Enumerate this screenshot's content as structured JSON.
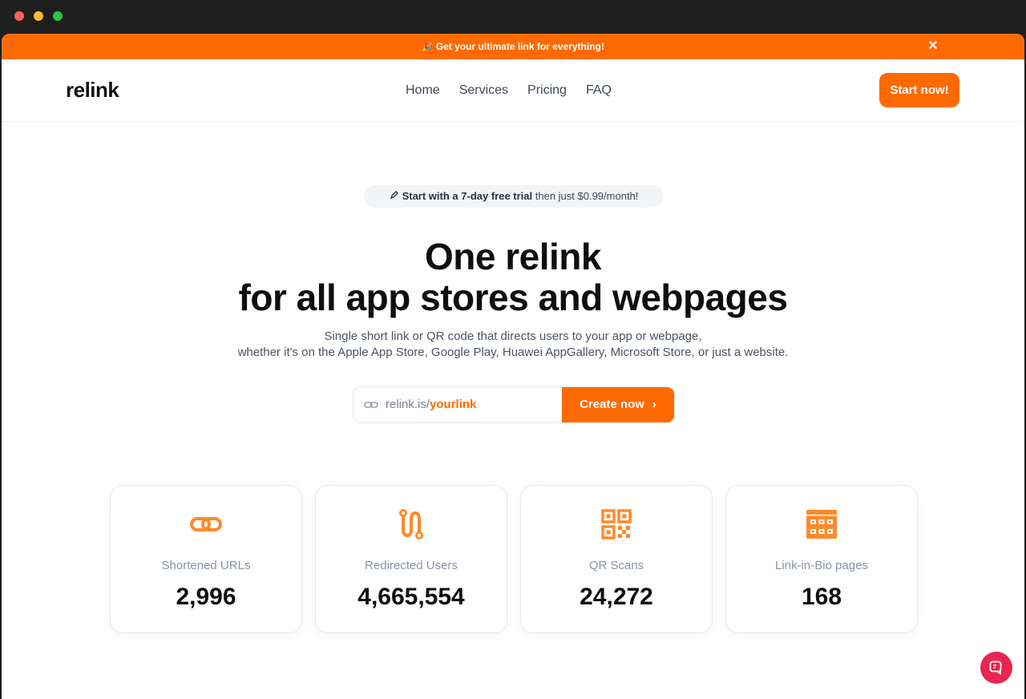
{
  "banner": {
    "icon": "🎉",
    "text": "Get your ultimate link for everything!",
    "close_label": "✕"
  },
  "nav": {
    "logo": "relink",
    "links": [
      "Home",
      "Services",
      "Pricing",
      "FAQ"
    ],
    "cta_label": "Start now!"
  },
  "hero": {
    "pill_bold": "Start with a 7-day free trial",
    "pill_rest": " then just $0.99/month!",
    "headline_line1": "One relink",
    "headline_line2": "for all app stores and webpages",
    "sub_line1": "Single short link or QR code that directs users to your app or webpage,",
    "sub_line2": "whether it's on the Apple App Store, Google Play, Huawei AppGallery, Microsoft Store, or just a website."
  },
  "create": {
    "prefix": "relink.is/",
    "placeholder": "yourlink",
    "button_label": "Create now",
    "arrow": "›"
  },
  "stats": [
    {
      "icon": "link-icon",
      "label": "Shortened URLs",
      "value": "2,996"
    },
    {
      "icon": "route-icon",
      "label": "Redirected Users",
      "value": "4,665,554"
    },
    {
      "icon": "qr-code-icon",
      "label": "QR Scans",
      "value": "24,272"
    },
    {
      "icon": "grid-page-icon",
      "label": "Link-in-Bio pages",
      "value": "168"
    }
  ],
  "colors": {
    "accent": "#ff6a00",
    "chat": "#e8264f"
  }
}
